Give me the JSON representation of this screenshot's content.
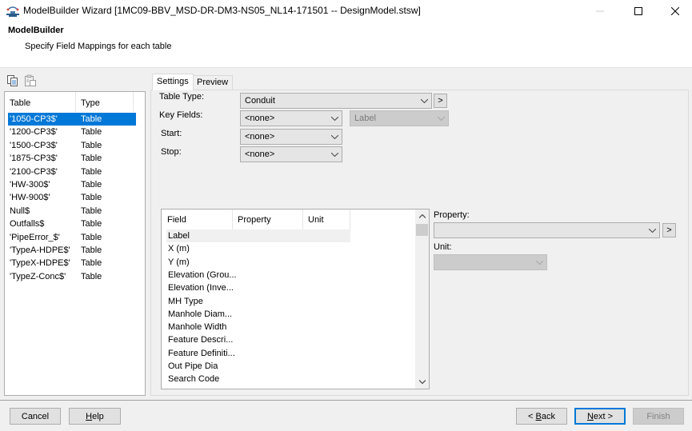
{
  "window": {
    "title": "ModelBuilder Wizard [1MC09-BBV_MSD-DR-DM3-NS05_NL14-171501 -- DesignModel.stsw]",
    "app_icon": "modelbuilder-icon",
    "controls": {
      "minimize": "—",
      "maximize": "☐",
      "close": "✕"
    }
  },
  "header": {
    "title": "ModelBuilder",
    "subtitle": "Specify Field Mappings for each table"
  },
  "toolbar": {
    "icons": [
      "copy-icon",
      "paste-icon"
    ]
  },
  "table_list": {
    "columns": [
      "Table",
      "Type"
    ],
    "selected_index": 0,
    "rows": [
      {
        "table": "'1050-CP3$'",
        "type": "Table"
      },
      {
        "table": "'1200-CP3$'",
        "type": "Table"
      },
      {
        "table": "'1500-CP3$'",
        "type": "Table"
      },
      {
        "table": "'1875-CP3$'",
        "type": "Table"
      },
      {
        "table": "'2100-CP3$'",
        "type": "Table"
      },
      {
        "table": "'HW-300$'",
        "type": "Table"
      },
      {
        "table": "'HW-900$'",
        "type": "Table"
      },
      {
        "table": "Null$",
        "type": "Table"
      },
      {
        "table": "Outfalls$",
        "type": "Table"
      },
      {
        "table": "'PipeError_$'",
        "type": "Table"
      },
      {
        "table": "'TypeA-HDPE$'",
        "type": "Table"
      },
      {
        "table": "'TypeX-HDPE$'",
        "type": "Table"
      },
      {
        "table": "'TypeZ-Conc$'",
        "type": "Table"
      }
    ]
  },
  "tabs": [
    {
      "label": "Settings",
      "active": true
    },
    {
      "label": "Preview",
      "active": false
    }
  ],
  "settings": {
    "table_type": {
      "label": "Table Type:",
      "value": "Conduit"
    },
    "key_fields": {
      "label": "Key Fields:",
      "value": "<none>",
      "secondary_value": "Label"
    },
    "start": {
      "label": "Start:",
      "value": "<none>"
    },
    "stop": {
      "label": "Stop:",
      "value": "<none>"
    },
    "arrow_label": ">"
  },
  "field_grid": {
    "columns": [
      "Field",
      "Property",
      "Unit"
    ],
    "rows": [
      "Label",
      "X (m)",
      "Y (m)",
      "Elevation (Grou...",
      "Elevation (Inve...",
      "MH Type",
      "Manhole Diam...",
      "Manhole Width",
      "Feature Descri...",
      "Feature Definiti...",
      "Out Pipe Dia",
      "Search Code"
    ],
    "current_index": 0
  },
  "property_panel": {
    "property_label": "Property:",
    "property_value": "",
    "unit_label": "Unit:",
    "unit_value": "",
    "arrow_label": ">"
  },
  "footer": {
    "cancel": "Cancel",
    "help_pre": "",
    "help_u": "H",
    "help_post": "elp",
    "back_pre": "< ",
    "back_u": "B",
    "back_post": "ack",
    "next_pre": "",
    "next_u": "N",
    "next_post": "ext >",
    "finish": "Finish"
  },
  "colors": {
    "selection": "#0078d7",
    "default_button_border": "#0078d7"
  }
}
